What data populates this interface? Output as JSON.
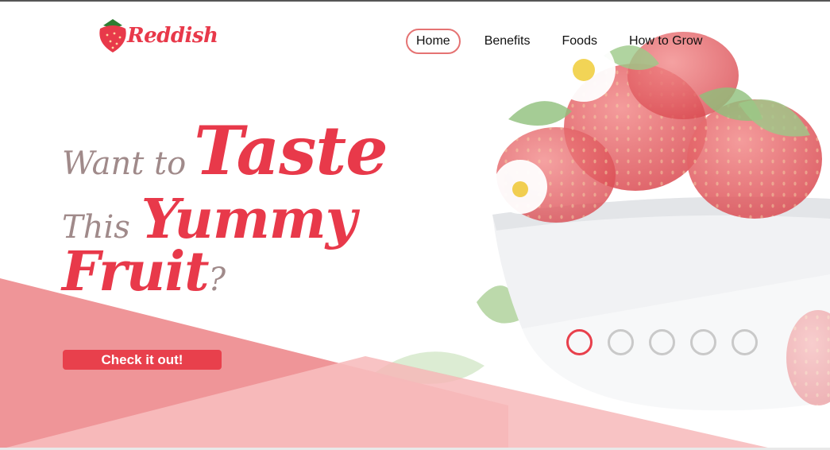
{
  "brand": {
    "name": "Reddish"
  },
  "nav": {
    "items": [
      {
        "label": "Home",
        "active": true
      },
      {
        "label": "Benefits",
        "active": false
      },
      {
        "label": "Foods",
        "active": false
      },
      {
        "label": "How to Grow",
        "active": false
      }
    ]
  },
  "hero": {
    "line1_small": "Want to",
    "line1_big": "Taste",
    "line2_small": "This",
    "line2_big": "Yummy",
    "line3_big": "Fruit",
    "line3_small": "?",
    "cta_label": "Check it out!"
  },
  "slider": {
    "count": 5,
    "active_index": 0
  },
  "colors": {
    "accent": "#e8394a",
    "muted": "#a08a8a",
    "dot_inactive": "#c9c9c9"
  }
}
